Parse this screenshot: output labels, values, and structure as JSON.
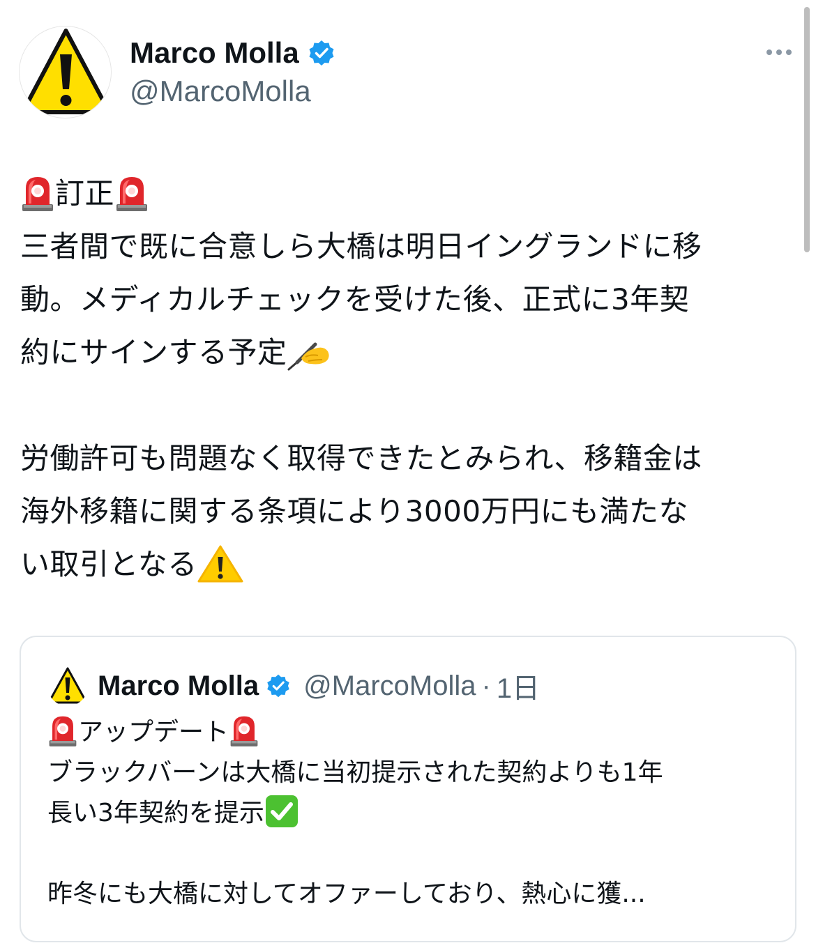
{
  "author": {
    "display_name": "Marco Molla",
    "handle": "@MarcoMolla",
    "avatar_icon": "warning-sign-icon",
    "verified_icon": "verified-badge-icon",
    "verified_color": "#1d9bf0"
  },
  "menu": {
    "more_icon": "more-options-icon"
  },
  "tweet": {
    "line1_text": "訂正",
    "line2": "三者間で既に合意しら大橋は明日イングランドに移",
    "line3": "動。メディカルチェックを受けた後、正式に3年契",
    "line4_text": "約にサインする予定",
    "line5": "労働許可も問題なく取得できたとみられ、移籍金は",
    "line6": "海外移籍に関する条項により3000万円にも満たな",
    "line7_text": "い取引となる",
    "emojis": [
      "rotating-light-icon",
      "writing-hand-icon",
      "warning-icon"
    ]
  },
  "quoted_tweet": {
    "display_name": "Marco Molla",
    "handle": "@MarcoMolla",
    "separator": "·",
    "time": "1日",
    "line1_text": "アップデート",
    "line2": "ブラックバーンは大橋に当初提示された契約よりも1年",
    "line3_text": "長い3年契約を提示",
    "line4": "昨冬にも大橋に対してオファーしており、熱心に獲...",
    "emojis": [
      "rotating-light-icon",
      "check-mark-button-icon"
    ]
  },
  "colors": {
    "text_primary": "#0f1419",
    "text_secondary": "#536471",
    "border": "#e1e6ea",
    "warning_yellow": "#ffdf00",
    "siren_red": "#e0262b",
    "check_green": "#4cc131"
  }
}
